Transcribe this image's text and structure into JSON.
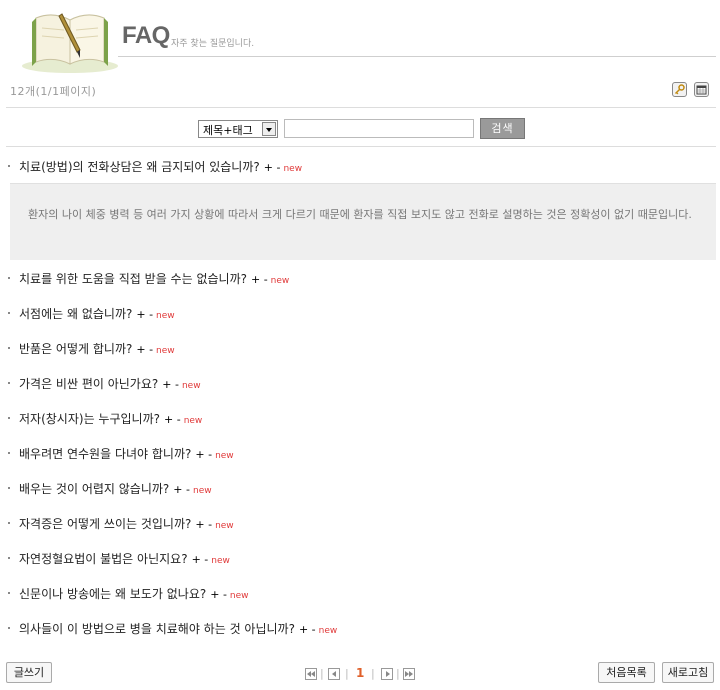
{
  "header": {
    "title": "FAQ",
    "subtitle": "자주 찾는 질문입니다."
  },
  "listinfo": {
    "count": "12개(1/1페이지)"
  },
  "search": {
    "select_value": "제목+태그",
    "input_value": "",
    "button_label": "검색"
  },
  "faq": {
    "plusminus": "+ -",
    "new_badge": "new",
    "items": [
      {
        "question": "치료(방법)의 전화상담은 왜 금지되어 있습니까?"
      },
      {
        "question": "치료를 위한 도움을 직접 받을 수는 없습니까?"
      },
      {
        "question": "서점에는 왜 없습니까?"
      },
      {
        "question": "반품은 어떻게 합니까?"
      },
      {
        "question": "가격은 비싼 편이 아닌가요?"
      },
      {
        "question": "저자(창시자)는 누구입니까?"
      },
      {
        "question": "배우려면 연수원을 다녀야 합니까?"
      },
      {
        "question": "배우는 것이 어렵지 않습니까?"
      },
      {
        "question": "자격증은 어떻게 쓰이는 것입니까?"
      },
      {
        "question": "자연정혈요법이 불법은 아닌지요?"
      },
      {
        "question": "신문이나 방송에는 왜 보도가 없나요?"
      },
      {
        "question": "의사들이 이 방법으로 병을 치료해야 하는 것 아닙니까?"
      }
    ],
    "open_answer": "환자의 나이 체중 병력 등 여러 가지 상황에 따라서 크게 다르기 때문에 환자를 직접 보지도 않고 전화로 설명하는 것은 정확성이 없기 때문입니다."
  },
  "footer": {
    "write_label": "글쓰기",
    "first_list_label": "처음목록",
    "refresh_label": "새로고침",
    "page_current": "1",
    "separator": "|"
  },
  "icons": [
    "book-logo-icon",
    "key-icon",
    "calendar-icon",
    "first-page-icon",
    "prev-page-icon",
    "next-page-icon",
    "last-page-icon"
  ],
  "colors": {
    "new_badge": "#e03a3a",
    "current_page": "#e0602a",
    "answer_bg": "#efefef",
    "search_button": "#9a9a9a"
  }
}
